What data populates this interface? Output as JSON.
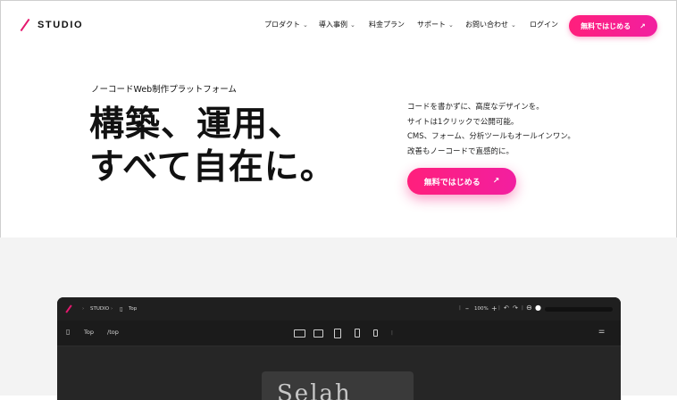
{
  "brand": {
    "name": "STUDIO",
    "accent": "#f21f7f"
  },
  "nav": {
    "items": [
      {
        "label": "プロダクト",
        "dropdown": true
      },
      {
        "label": "導入事例",
        "dropdown": true
      },
      {
        "label": "料金プラン",
        "dropdown": false
      },
      {
        "label": "サポート",
        "dropdown": true
      },
      {
        "label": "お問い合わせ",
        "dropdown": true
      },
      {
        "label": "ログイン",
        "dropdown": false
      }
    ],
    "cta_label": "無料ではじめる"
  },
  "hero": {
    "kicker": "ノーコードWeb制作プラットフォーム",
    "headline_line1": "構築、運用、",
    "headline_line2": "すべて自在に。",
    "copy": [
      "コードを書かずに、高度なデザインを。",
      "サイトは1クリックで公開可能。",
      "CMS、フォーム、分析ツールもオールインワン。",
      "改善もノーコードで直感的に。"
    ],
    "cta_label": "無料ではじめる"
  },
  "editor": {
    "breadcrumb_brand": "STUDIO",
    "breadcrumb_page": "Top",
    "zoom": "100%",
    "page_name": "Top",
    "page_path": "/top",
    "canvas_text": "Selah"
  }
}
